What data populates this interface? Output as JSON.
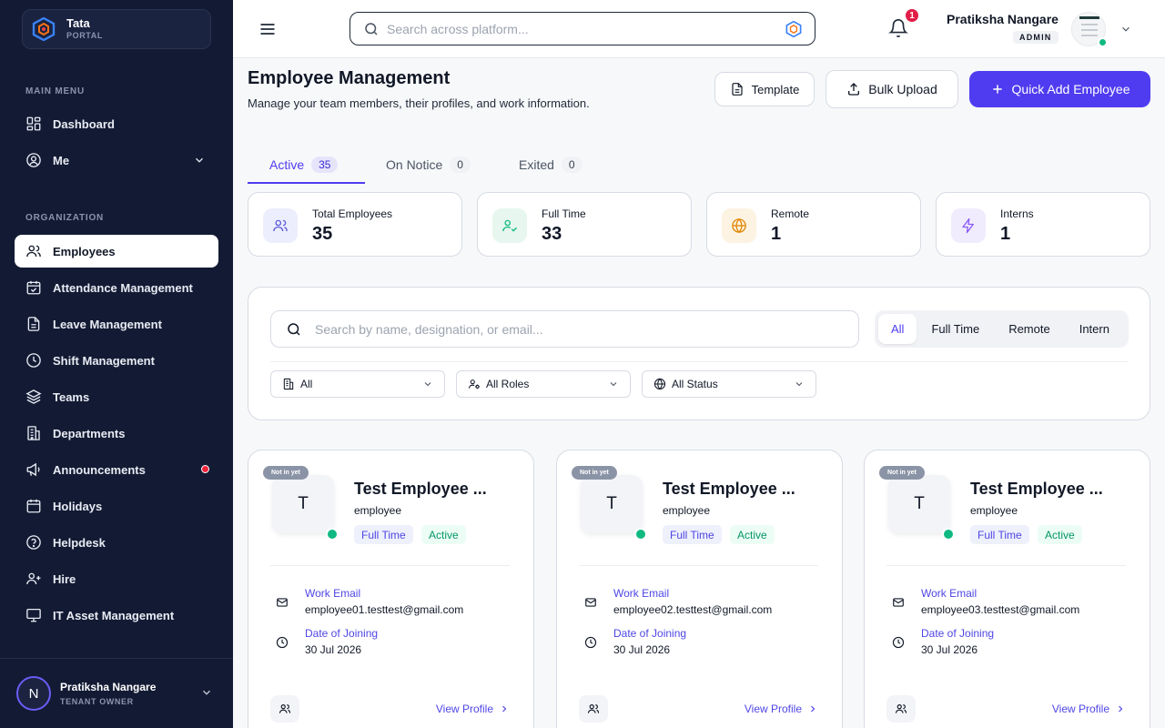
{
  "brand": {
    "name": "Tata",
    "sub": "PORTAL"
  },
  "sidebar": {
    "main_menu_label": "MAIN MENU",
    "organization_label": "ORGANIZATION",
    "main_items": [
      {
        "label": "Dashboard",
        "icon": "dashboard-icon"
      },
      {
        "label": "Me",
        "icon": "user-circle-icon"
      }
    ],
    "org_items": [
      {
        "label": "Employees",
        "icon": "users-icon",
        "active": true
      },
      {
        "label": "Attendance Management",
        "icon": "calendar-check-icon"
      },
      {
        "label": "Leave Management",
        "icon": "document-icon"
      },
      {
        "label": "Shift Management",
        "icon": "clock-icon"
      },
      {
        "label": "Teams",
        "icon": "layers-icon"
      },
      {
        "label": "Departments",
        "icon": "building-icon"
      },
      {
        "label": "Announcements",
        "icon": "megaphone-icon"
      },
      {
        "label": "Holidays",
        "icon": "calendar-icon"
      },
      {
        "label": "Helpdesk",
        "icon": "help-circle-icon"
      },
      {
        "label": "Hire",
        "icon": "user-plus-icon"
      },
      {
        "label": "IT Asset Management",
        "icon": "monitor-icon"
      }
    ],
    "footer": {
      "initial": "N",
      "name": "Pratiksha Nangare",
      "role": "TENANT OWNER"
    }
  },
  "header": {
    "search_placeholder": "Search across platform...",
    "notification_count": "1",
    "user_name": "Pratiksha Nangare",
    "user_role": "ADMIN"
  },
  "page": {
    "title": "Employee Management",
    "subtitle": "Manage your team members, their profiles, and work information.",
    "buttons": {
      "template": "Template",
      "bulk_upload": "Bulk Upload",
      "quick_add": "Quick Add Employee"
    }
  },
  "tabs": [
    {
      "label": "Active",
      "count": "35"
    },
    {
      "label": "On Notice",
      "count": "0"
    },
    {
      "label": "Exited",
      "count": "0"
    }
  ],
  "stats": [
    {
      "label": "Total Employees",
      "value": "35",
      "icon": "users-icon",
      "bg": "#eceefd",
      "color": "#5b5bd6"
    },
    {
      "label": "Full Time",
      "value": "33",
      "icon": "user-check-icon",
      "bg": "#e7f7ef",
      "color": "#10b981"
    },
    {
      "label": "Remote",
      "value": "1",
      "icon": "globe-icon",
      "bg": "#fdf3e2",
      "color": "#e08a0b"
    },
    {
      "label": "Interns",
      "value": "1",
      "icon": "lightning-icon",
      "bg": "#f1ecfd",
      "color": "#8b5cf6"
    }
  ],
  "filters": {
    "search_placeholder": "Search by name, designation, or email...",
    "segments": [
      "All",
      "Full Time",
      "Remote",
      "Intern"
    ],
    "selects": [
      {
        "value": "All",
        "icon": "building-icon"
      },
      {
        "value": "All Roles",
        "icon": "user-cog-icon"
      },
      {
        "value": "All Status",
        "icon": "globe-icon"
      }
    ]
  },
  "cards": [
    {
      "badge": "Not in yet",
      "initial": "T",
      "name": "Test Employee ...",
      "role": "employee",
      "type": "Full Time",
      "status": "Active",
      "email_label": "Work Email",
      "email": "employee01.testtest@gmail.com",
      "doj_label": "Date of Joining",
      "doj": "30 Jul 2026",
      "view": "View Profile"
    },
    {
      "badge": "Not in yet",
      "initial": "T",
      "name": "Test Employee ...",
      "role": "employee",
      "type": "Full Time",
      "status": "Active",
      "email_label": "Work Email",
      "email": "employee02.testtest@gmail.com",
      "doj_label": "Date of Joining",
      "doj": "30 Jul 2026",
      "view": "View Profile"
    },
    {
      "badge": "Not in yet",
      "initial": "T",
      "name": "Test Employee ...",
      "role": "employee",
      "type": "Full Time",
      "status": "Active",
      "email_label": "Work Email",
      "email": "employee03.testtest@gmail.com",
      "doj_label": "Date of Joining",
      "doj": "30 Jul 2026",
      "view": "View Profile"
    }
  ],
  "colors": {
    "accent": "#4f3cf0",
    "sidebar_bg": "#131b34",
    "online": "#10b981",
    "alert": "#e11d48"
  }
}
